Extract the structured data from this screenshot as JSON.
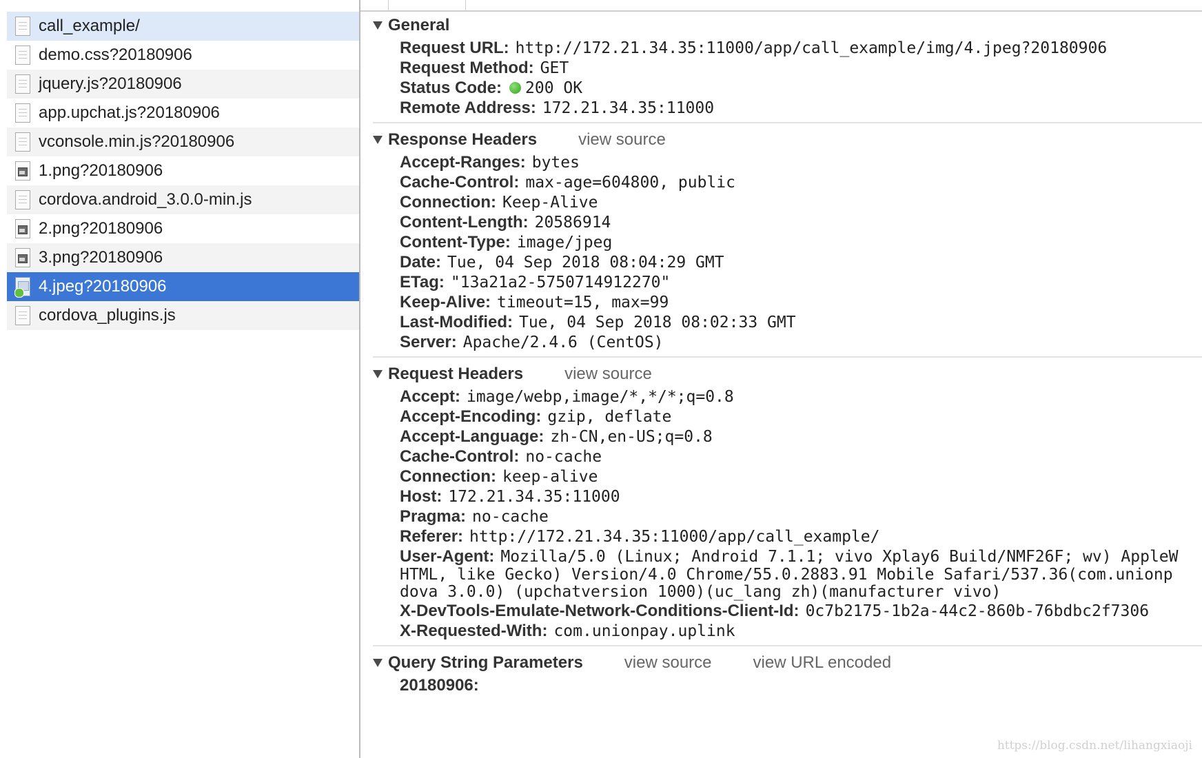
{
  "files": [
    {
      "name": "call_example/",
      "type": "doc"
    },
    {
      "name": "demo.css?20180906",
      "type": "doc"
    },
    {
      "name": "jquery.js?20180906",
      "type": "doc"
    },
    {
      "name": "app.upchat.js?20180906",
      "type": "doc"
    },
    {
      "name": "vconsole.min.js?20180906",
      "type": "doc"
    },
    {
      "name": "1.png?20180906",
      "type": "img"
    },
    {
      "name": "cordova.android_3.0.0-min.js",
      "type": "doc"
    },
    {
      "name": "2.png?20180906",
      "type": "img"
    },
    {
      "name": "3.png?20180906",
      "type": "img"
    },
    {
      "name": "4.jpeg?20180906",
      "type": "jpeg",
      "selected": true
    },
    {
      "name": "cordova_plugins.js",
      "type": "doc"
    }
  ],
  "general": {
    "title": "General",
    "rows": [
      {
        "key": "Request URL:",
        "value": "http://172.21.34.35:11000/app/call_example/img/4.jpeg?20180906"
      },
      {
        "key": "Request Method:",
        "value": "GET"
      },
      {
        "key": "Status Code:",
        "value": "200 OK",
        "status_color": "#2fa417"
      },
      {
        "key": "Remote Address:",
        "value": "172.21.34.35:11000"
      }
    ]
  },
  "response_headers": {
    "title": "Response Headers",
    "view_source": "view source",
    "rows": [
      {
        "key": "Accept-Ranges:",
        "value": "bytes"
      },
      {
        "key": "Cache-Control:",
        "value": "max-age=604800, public"
      },
      {
        "key": "Connection:",
        "value": "Keep-Alive"
      },
      {
        "key": "Content-Length:",
        "value": "20586914"
      },
      {
        "key": "Content-Type:",
        "value": "image/jpeg"
      },
      {
        "key": "Date:",
        "value": "Tue, 04 Sep 2018 08:04:29 GMT"
      },
      {
        "key": "ETag:",
        "value": "\"13a21a2-5750714912270\""
      },
      {
        "key": "Keep-Alive:",
        "value": "timeout=15, max=99"
      },
      {
        "key": "Last-Modified:",
        "value": "Tue, 04 Sep 2018 08:02:33 GMT"
      },
      {
        "key": "Server:",
        "value": "Apache/2.4.6 (CentOS)"
      }
    ]
  },
  "request_headers": {
    "title": "Request Headers",
    "view_source": "view source",
    "rows": [
      {
        "key": "Accept:",
        "value": "image/webp,image/*,*/*;q=0.8"
      },
      {
        "key": "Accept-Encoding:",
        "value": "gzip, deflate"
      },
      {
        "key": "Accept-Language:",
        "value": "zh-CN,en-US;q=0.8"
      },
      {
        "key": "Cache-Control:",
        "value": "no-cache"
      },
      {
        "key": "Connection:",
        "value": "keep-alive"
      },
      {
        "key": "Host:",
        "value": "172.21.34.35:11000"
      },
      {
        "key": "Pragma:",
        "value": "no-cache"
      },
      {
        "key": "Referer:",
        "value": "http://172.21.34.35:11000/app/call_example/"
      }
    ],
    "user_agent": {
      "key": "User-Agent:",
      "line1": "Mozilla/5.0 (Linux; Android 7.1.1; vivo Xplay6 Build/NMF26F; wv) AppleW",
      "line2": "HTML, like Gecko) Version/4.0 Chrome/55.0.2883.91 Mobile Safari/537.36(com.unionp",
      "line3": "dova 3.0.0) (upchatversion 1000)(uc_lang zh)(manufacturer vivo)"
    },
    "rows_after": [
      {
        "key": "X-DevTools-Emulate-Network-Conditions-Client-Id:",
        "value": "0c7b2175-1b2a-44c2-860b-76bdbc2f7306"
      },
      {
        "key": "X-Requested-With:",
        "value": "com.unionpay.uplink"
      }
    ]
  },
  "query_string": {
    "title": "Query String Parameters",
    "view_source": "view source",
    "view_url_encoded": "view URL encoded",
    "rows": [
      {
        "key": "20180906:",
        "value": ""
      }
    ]
  },
  "watermark": "https://blog.csdn.net/lihangxiaoji"
}
